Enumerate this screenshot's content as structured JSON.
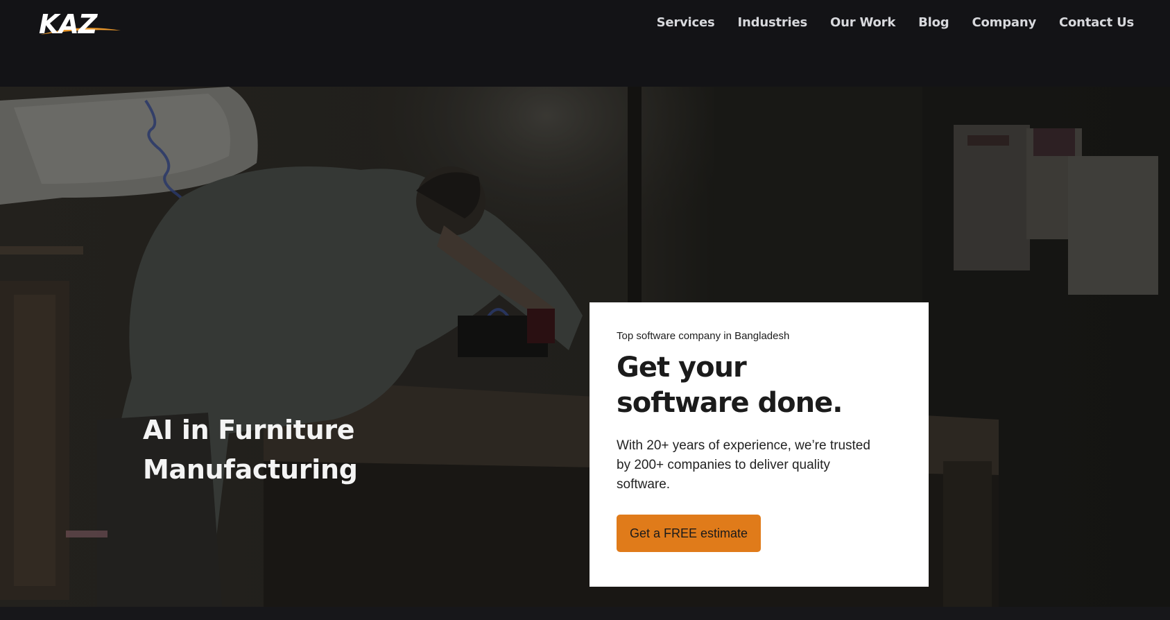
{
  "header": {
    "logo_text": "KAZ",
    "nav": [
      {
        "label": "Services"
      },
      {
        "label": "Industries"
      },
      {
        "label": "Our Work"
      },
      {
        "label": "Blog"
      },
      {
        "label": "Company"
      },
      {
        "label": "Contact Us"
      }
    ]
  },
  "hero": {
    "title": "AI in Furniture Manufacturing",
    "image_subject": "carpenter-working-at-workbench"
  },
  "card": {
    "eyebrow": "Top software company in Bangladesh",
    "headline": "Get your software done.",
    "body": "With 20+ years of experience, we’re trusted by 200+ companies to deliver quality software.",
    "cta_label": "Get a FREE estimate"
  },
  "colors": {
    "header_bg": "#131316",
    "accent": "#e07b1a",
    "card_bg": "#ffffff",
    "nav_text": "#d8d9dd"
  }
}
